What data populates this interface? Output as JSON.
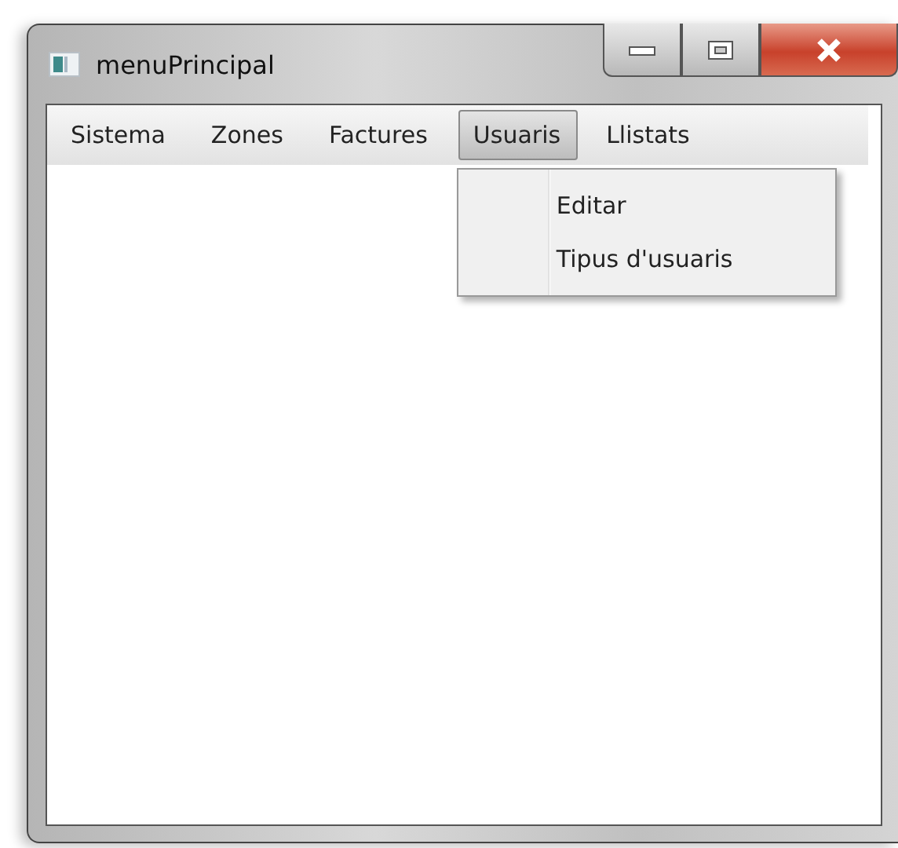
{
  "window": {
    "title": "menuPrincipal"
  },
  "menu_bar": [
    {
      "label": "Sistema",
      "selected": false
    },
    {
      "label": "Zones",
      "selected": false
    },
    {
      "label": "Factures",
      "selected": false
    },
    {
      "label": "Usuaris",
      "selected": true,
      "items": [
        "Editar",
        "Tipus d'usuaris"
      ]
    },
    {
      "label": "Llistats",
      "selected": false
    }
  ]
}
